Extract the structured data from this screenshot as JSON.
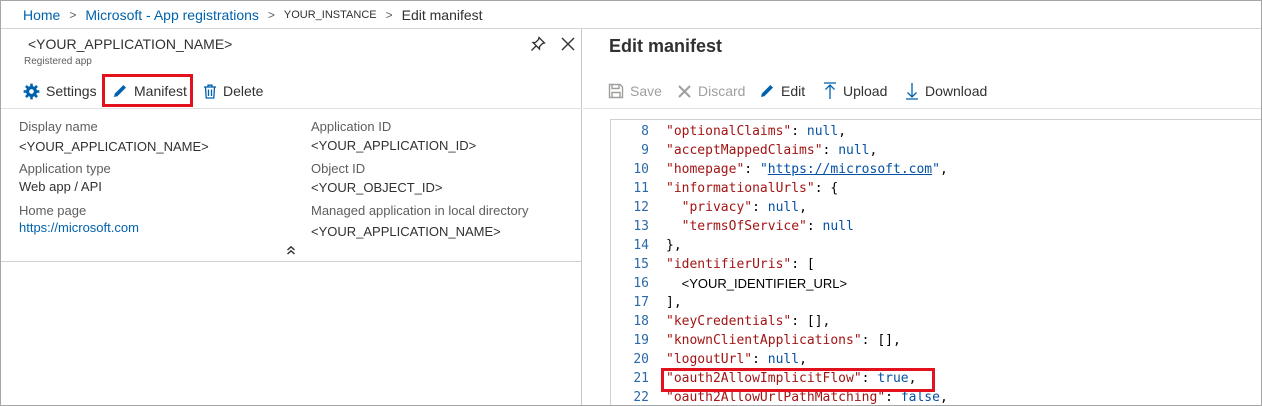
{
  "breadcrumb": {
    "home": "Home",
    "app_registrations": "Microsoft - App registrations",
    "instance": "YOUR_INSTANCE",
    "current": "Edit manifest"
  },
  "app_blade": {
    "title": "<YOUR_APPLICATION_NAME>",
    "subtitle": "Registered app",
    "toolbar": {
      "settings_label": "Settings",
      "manifest_label": "Manifest",
      "delete_label": "Delete"
    },
    "properties": {
      "display_name_label": "Display name",
      "display_name_value": "<YOUR_APPLICATION_NAME>",
      "application_type_label": "Application type",
      "application_type_value": "Web app / API",
      "home_page_label": "Home page",
      "home_page_value": "https://microsoft.com",
      "application_id_label": "Application ID",
      "application_id_value": "<YOUR_APPLICATION_ID>",
      "object_id_label": "Object ID",
      "object_id_value": "<YOUR_OBJECT_ID>",
      "managed_app_label": "Managed application in local directory",
      "managed_app_value": "<YOUR_APPLICATION_NAME>"
    }
  },
  "manifest_blade": {
    "title": "Edit manifest",
    "toolbar": {
      "save_label": "Save",
      "discard_label": "Discard",
      "edit_label": "Edit",
      "upload_label": "Upload",
      "download_label": "Download"
    },
    "lines": [
      {
        "n": "8",
        "tokens": [
          {
            "t": "\"optionalClaims\"",
            "c": "k"
          },
          {
            "t": ": ",
            "c": "p"
          },
          {
            "t": "null",
            "c": "v"
          },
          {
            "t": ",",
            "c": "p"
          }
        ]
      },
      {
        "n": "9",
        "tokens": [
          {
            "t": "\"acceptMappedClaims\"",
            "c": "k"
          },
          {
            "t": ": ",
            "c": "p"
          },
          {
            "t": "null",
            "c": "v"
          },
          {
            "t": ",",
            "c": "p"
          }
        ]
      },
      {
        "n": "10",
        "tokens": [
          {
            "t": "\"homepage\"",
            "c": "k"
          },
          {
            "t": ": ",
            "c": "p"
          },
          {
            "t": "\"",
            "c": "v"
          },
          {
            "t": "https://microsoft.com",
            "c": "u"
          },
          {
            "t": "\"",
            "c": "v"
          },
          {
            "t": ",",
            "c": "p"
          }
        ]
      },
      {
        "n": "11",
        "tokens": [
          {
            "t": "\"informationalUrls\"",
            "c": "k"
          },
          {
            "t": ": {",
            "c": "p"
          }
        ]
      },
      {
        "n": "12",
        "tokens": [
          {
            "t": "  ",
            "c": "p"
          },
          {
            "t": "\"privacy\"",
            "c": "k"
          },
          {
            "t": ": ",
            "c": "p"
          },
          {
            "t": "null",
            "c": "v"
          },
          {
            "t": ",",
            "c": "p"
          }
        ]
      },
      {
        "n": "13",
        "tokens": [
          {
            "t": "  ",
            "c": "p"
          },
          {
            "t": "\"termsOfService\"",
            "c": "k"
          },
          {
            "t": ": ",
            "c": "p"
          },
          {
            "t": "null",
            "c": "v"
          }
        ]
      },
      {
        "n": "14",
        "tokens": [
          {
            "t": "},",
            "c": "p"
          }
        ]
      },
      {
        "n": "15",
        "tokens": [
          {
            "t": "\"identifierUris\"",
            "c": "k"
          },
          {
            "t": ": [",
            "c": "p"
          }
        ]
      },
      {
        "n": "16",
        "tokens": [
          {
            "t": "  ",
            "c": "p"
          },
          {
            "t": "<YOUR_IDENTIFIER_URL>",
            "c": "plain"
          }
        ]
      },
      {
        "n": "17",
        "tokens": [
          {
            "t": "],",
            "c": "p"
          }
        ]
      },
      {
        "n": "18",
        "tokens": [
          {
            "t": "\"keyCredentials\"",
            "c": "k"
          },
          {
            "t": ": [],",
            "c": "p"
          }
        ]
      },
      {
        "n": "19",
        "tokens": [
          {
            "t": "\"knownClientApplications\"",
            "c": "k"
          },
          {
            "t": ": [],",
            "c": "p"
          }
        ]
      },
      {
        "n": "20",
        "tokens": [
          {
            "t": "\"logoutUrl\"",
            "c": "k"
          },
          {
            "t": ": ",
            "c": "p"
          },
          {
            "t": "null",
            "c": "v"
          },
          {
            "t": ",",
            "c": "p"
          }
        ]
      },
      {
        "n": "21",
        "tokens": [
          {
            "t": "\"oauth2AllowImplicitFlow\"",
            "c": "k"
          },
          {
            "t": ": ",
            "c": "p"
          },
          {
            "t": "true",
            "c": "v"
          },
          {
            "t": ",",
            "c": "p"
          }
        ]
      },
      {
        "n": "22",
        "tokens": [
          {
            "t": "\"oauth2AllowUrlPathMatching\"",
            "c": "k"
          },
          {
            "t": ": ",
            "c": "p"
          },
          {
            "t": "false",
            "c": "v"
          },
          {
            "t": ",",
            "c": "p"
          }
        ]
      }
    ]
  },
  "colors": {
    "link": "#0062ad",
    "highlight": "#e3111d",
    "json_key": "#a31515",
    "json_value": "#0451a5",
    "line_number": "#2b6aa8"
  }
}
